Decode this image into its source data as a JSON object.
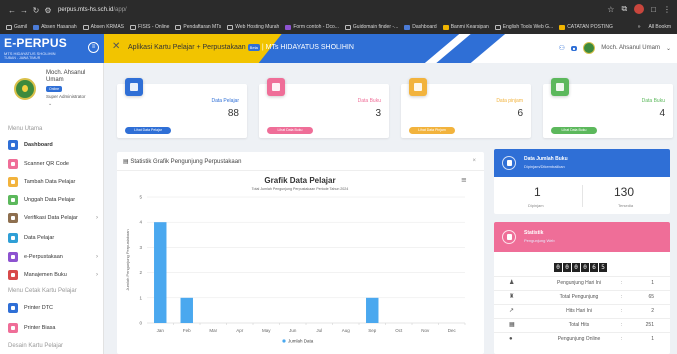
{
  "browser": {
    "url_host": "perpus.mts-hs.sch.id",
    "url_path": "/app/",
    "bookmarks": [
      "Gamil",
      "Absen Hasanah",
      "Absen KRMAS",
      "FISIS - Online",
      "Pendaftaran MTs",
      "Web Hosting Murah",
      "Form contoh - Dco...",
      "Guidomain finder -...",
      "Dashboard",
      "Banmi Kearsipan",
      "English Tools Web G...",
      "CATATAN POSTING"
    ],
    "bookmarks_right": "All Bookm"
  },
  "sidebar": {
    "brand": "E-PERPUS",
    "brand_sub": "MTS HIDAYATUS SHOLIHIN",
    "brand_sub2": "TUBAN - JAWA TIMUR",
    "user_name": "Moch. Ahsanul Umam",
    "user_badge": "Online",
    "user_role": "Super Administrator",
    "menu_heading_1": "Menu Utama",
    "menu_heading_2": "Menu Cetak Kartu Pelajar",
    "menu_heading_3": "Desain Kartu Pelajar",
    "items": [
      {
        "label": "Dashboard",
        "color": "#2f6fd6"
      },
      {
        "label": "Scanner QR Code",
        "color": "#ef6e98"
      },
      {
        "label": "Tambah Data Pelajar",
        "color": "#f2b33d"
      },
      {
        "label": "Unggah Data Pelajar",
        "color": "#5cb85c"
      },
      {
        "label": "Verifikasi Data Pelajar",
        "color": "#8e6f4f"
      },
      {
        "label": "Data Pelajar",
        "color": "#2f9fd6"
      },
      {
        "label": "e-Perpustakaan",
        "color": "#8d53d0"
      },
      {
        "label": "Manajemen Buku",
        "color": "#d84a4a"
      },
      {
        "label": "Printer DTC",
        "color": "#2f6fd6"
      },
      {
        "label": "Printer Biasa",
        "color": "#ef6e98"
      }
    ]
  },
  "topbar": {
    "app_title": "Aplikasi Kartu Pelajar + Perpustakaan",
    "beta": "Beta",
    "school": "| MTs HIDAYATUS SHOLIHIN",
    "user": "Moch. Ahsanul Umam"
  },
  "stats": [
    {
      "label": "Data Pelajar",
      "value": "88",
      "button": "Lihat Data Pelajar",
      "color": "#2f6fd6"
    },
    {
      "label": "Data Buku",
      "value": "3",
      "button": "Lihat Data Buku",
      "color": "#ef6e98"
    },
    {
      "label": "Data pinjam",
      "value": "6",
      "button": "Lihat Data Pinjam",
      "color": "#f2b33d"
    },
    {
      "label": "Data Buku",
      "value": "4",
      "button": "Lihat Data Buku",
      "color": "#5cb85c"
    }
  ],
  "chart_panel": {
    "heading": "Statistik Grafik Pengunjung Perpustakaan",
    "close": "×"
  },
  "chart_data": {
    "type": "bar",
    "title": "Grafik Data Pelajar",
    "subtitle": "Total Jumlah Pengunjung Perpustakaan Periode Tahun 2024",
    "ylabel": "Jumlah Pengunjung Perpustakaan",
    "categories": [
      "Jan",
      "Feb",
      "Mar",
      "Apr",
      "May",
      "Jun",
      "Jul",
      "Aug",
      "Sep",
      "Oct",
      "Nov",
      "Dec"
    ],
    "series": [
      {
        "name": "Jumlah Data",
        "values": [
          4,
          1,
          0,
          0,
          0,
          0,
          0,
          0,
          1,
          0,
          0,
          0
        ]
      }
    ],
    "ylim": [
      0,
      5
    ],
    "yticks": [
      0,
      1,
      2,
      3,
      4,
      5
    ],
    "grid": true,
    "legend": "bottom",
    "bar_color": "#4aa8ef"
  },
  "buku_panel": {
    "title": "Data Jumlah Buku",
    "subtitle": "Dipinjam/Dikembalikan",
    "left_value": "1",
    "left_caption": "Dipinjam",
    "right_value": "130",
    "right_caption": "Tersedia"
  },
  "stat_panel": {
    "title": "Statistik",
    "subtitle": "Pengunjung Web",
    "counter": [
      "0",
      "0",
      "0",
      "0",
      "6",
      "5"
    ],
    "rows": [
      {
        "label": "Pengunjung Hari Ini",
        "value": "1",
        "icon": "♟"
      },
      {
        "label": "Total Pengunjung",
        "value": "65",
        "icon": "♜"
      },
      {
        "label": "Hits Hari Ini",
        "value": "2",
        "icon": "↗"
      },
      {
        "label": "Total Hits",
        "value": "251",
        "icon": "▦"
      },
      {
        "label": "Pengunjung Online",
        "value": "1",
        "icon": "●"
      }
    ]
  }
}
